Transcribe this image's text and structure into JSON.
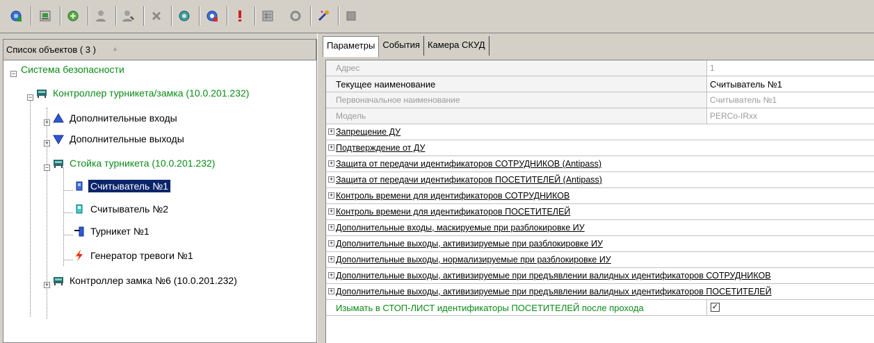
{
  "toolbar": {
    "buttons": [
      {
        "icon": "add-device-icon"
      },
      {
        "icon": "configure-icon"
      },
      {
        "icon": "connect-icon"
      },
      {
        "icon": "user-icon"
      },
      {
        "icon": "edit-user-icon"
      },
      {
        "icon": "delete-icon"
      },
      {
        "icon": "refresh-icon"
      },
      {
        "icon": "update-icon"
      },
      {
        "icon": "alarm-icon"
      },
      {
        "icon": "map-icon"
      },
      {
        "icon": "recycle-icon"
      },
      {
        "icon": "magic-wand-icon"
      },
      {
        "icon": "panel-icon"
      }
    ]
  },
  "left_panel": {
    "header": "Список объектов ( 3 )",
    "sort_indicator": "▲",
    "tree": [
      {
        "label": "Система безопасности",
        "level": 0,
        "icon": "none",
        "style": "green"
      },
      {
        "label": "Контроллер турникета/замка (10.0.201.232)",
        "level": 1,
        "icon": "controller-icon",
        "style": "green"
      },
      {
        "label": "Дополнительные входы",
        "level": 2,
        "icon": "inputs-icon",
        "style": "normal"
      },
      {
        "label": "Дополнительные выходы",
        "level": 2,
        "icon": "outputs-icon",
        "style": "normal"
      },
      {
        "label": "Стойка турникета (10.0.201.232)",
        "level": 2,
        "icon": "turnstile-stand-icon",
        "style": "green"
      },
      {
        "label": "Считыватель №1",
        "level": 3,
        "icon": "reader-icon",
        "style": "selected"
      },
      {
        "label": "Считыватель №2",
        "level": 3,
        "icon": "reader-icon",
        "style": "normal"
      },
      {
        "label": "Турникет №1",
        "level": 3,
        "icon": "turnstile-icon",
        "style": "normal"
      },
      {
        "label": "Генератор тревоги №1",
        "level": 3,
        "icon": "alarm-generator-icon",
        "style": "normal"
      },
      {
        "label": "Контроллер замка №6 (10.0.201.232)",
        "level": 2,
        "icon": "lock-controller-icon",
        "style": "normal"
      }
    ]
  },
  "right_panel": {
    "tabs": [
      {
        "label": "Параметры",
        "active": true
      },
      {
        "label": "События",
        "active": false
      },
      {
        "label": "Камера СКУД",
        "active": false
      }
    ],
    "properties": [
      {
        "key": "Адрес",
        "value": "1",
        "disabled": true
      },
      {
        "key": "Текущее наименование",
        "value": "Считыватель №1",
        "disabled": false
      },
      {
        "key": "Первоначальное наименование",
        "value": "Считыватель №1",
        "disabled": true
      },
      {
        "key": "Модель",
        "value": "PERCo-IRxx",
        "disabled": true
      }
    ],
    "categories": [
      "Запрещение ДУ",
      "Подтверждение от ДУ",
      "Защита от передачи идентификаторов СОТРУДНИКОВ (Antipass)",
      "Защита от передачи идентификаторов ПОСЕТИТЕЛЕЙ (Antipass)",
      "Контроль времени для идентификаторов СОТРУДНИКОВ",
      "Контроль времени для идентификаторов ПОСЕТИТЕЛЕЙ",
      "Дополнительные входы, маскируемые при разблокировке ИУ",
      "Дополнительные выходы, активизируемые при разблокировке ИУ",
      "Дополнительные выходы, нормализируемые при разблокировке ИУ",
      "Дополнительные выходы, активизируемые при предъявлении валидных идентификаторов СОТРУДНИКОВ",
      "Дополнительные выходы, активизируемые при предъявлении валидных идентификаторов ПОСЕТИТЕЛЕЙ"
    ],
    "checkbox_row": {
      "label": "Изымать в СТОП-ЛИСТ идентификаторы ПОСЕТИТЕЛЕЙ после прохода",
      "checked": true,
      "check_glyph": "✓"
    }
  },
  "colors": {
    "selection": "#0a246a",
    "green_text": "#0a8a16",
    "window_bg": "#d4d0c8"
  }
}
